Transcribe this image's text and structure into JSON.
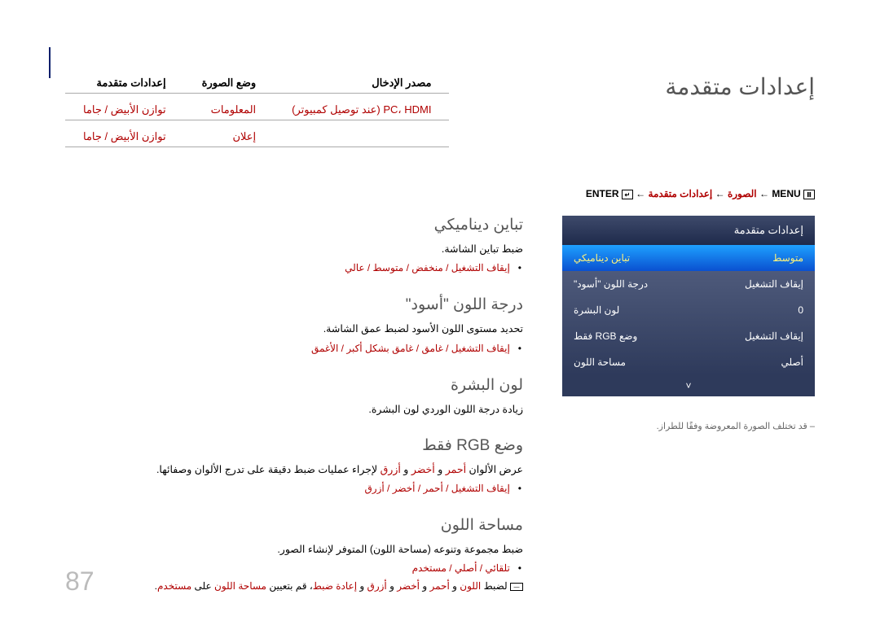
{
  "title": "إعدادات متقدمة",
  "columns": {
    "headers": [
      "مصدر الإدخال",
      "وضع الصورة",
      "إعدادات متقدمة"
    ],
    "row1": [
      "PC، HDMI (عند توصيل كمبيوتر)",
      "المعلومات",
      "توازن الأبيض / جاما"
    ],
    "row2_b": "إعلان",
    "row2_c": "توازن الأبيض / جاما"
  },
  "breadcrumb": {
    "menu": "MENU",
    "pic": "الصورة",
    "adv": "إعدادات متقدمة",
    "enter": "ENTER"
  },
  "menu": {
    "header": "إعدادات متقدمة",
    "rows": [
      {
        "l": "متوسط",
        "r": "تباين ديناميكي"
      },
      {
        "l": "إيقاف التشغيل",
        "r": "درجة اللون \"أسود\""
      },
      {
        "l": "0",
        "r": "لون البشرة"
      },
      {
        "l": "إيقاف التشغيل",
        "r": "وضع RGB فقط"
      },
      {
        "l": "أصلي",
        "r": "مساحة اللون"
      }
    ],
    "chev": "˅"
  },
  "footnote": "قد تختلف الصورة المعروضة وفقًا للطراز.",
  "sections": {
    "s1": {
      "h": "تباين ديناميكي",
      "p": "ضبط تباين الشاشة.",
      "b": "إيقاف التشغيل / منخفض / متوسط / عالي"
    },
    "s2": {
      "h": "درجة اللون \"أسود\"",
      "p": "تحديد مستوى اللون الأسود لضبط عمق الشاشة.",
      "b": "إيقاف التشغيل / غامق / غامق بشكل أكبر / الأغمق"
    },
    "s3": {
      "h": "لون البشرة",
      "p": "زيادة درجة اللون الوردي لون البشرة."
    },
    "s4": {
      "h": "وضع RGB فقط",
      "p1a": "عرض الألوان ",
      "p1_r": "أحمر",
      "p1b": " و ",
      "p1_g": "أخضر",
      "p1c": " و ",
      "p1_bl": "أزرق",
      "p1d": " لإجراء عمليات ضبط دقيقة على تدرج الألوان وصفائها.",
      "b": "إيقاف التشغيل / أحمر / أخضر / أزرق"
    },
    "s5": {
      "h": "مساحة اللون",
      "p": "ضبط مجموعة وتنوعه (مساحة اللون) المتوفر لإنشاء الصور.",
      "b": "تلقائي / أصلي / مستخدم",
      "note_a": "لضبط ",
      "note_b": "اللون",
      "note_c": " و ",
      "note_d": "أحمر",
      "note_e": " و ",
      "note_f": "أخضر",
      "note_g": " و ",
      "note_h": "أزرق",
      "note_i": " و ",
      "note_j": "إعادة ضبط",
      "note_k": "، قم بتعيين ",
      "note_l": "مساحة اللون",
      "note_m": " على ",
      "note_n": "مستخدم",
      "note_o": "."
    }
  },
  "page_num": "87"
}
